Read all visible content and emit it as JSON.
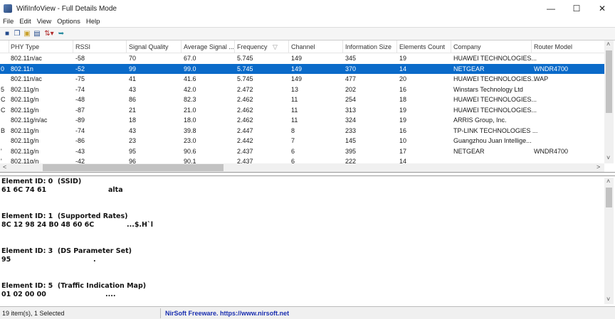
{
  "window": {
    "title": "WifiInfoView  -  Full Details Mode"
  },
  "menu": [
    "File",
    "Edit",
    "View",
    "Options",
    "Help"
  ],
  "toolbar": {
    "icons": [
      "save-icon",
      "copy-icon",
      "properties-icon",
      "html-report-icon",
      "sort-icon",
      "exit-icon"
    ]
  },
  "columns": [
    "PHY Type",
    "RSSI",
    "Signal Quality",
    "Average Signal ...",
    "Frequency",
    "Channel",
    "Information Size",
    "Elements Count",
    "Company",
    "Router Model"
  ],
  "rows": [
    {
      "c0": "",
      "phy": "802.11n/ac",
      "rssi": "-58",
      "sq": "70",
      "avg": "67.0",
      "freq": "5.745",
      "ch": "149",
      "info": "345",
      "elem": "19",
      "company": "HUAWEI TECHNOLOGIES...",
      "model": ""
    },
    {
      "c0": "0",
      "phy": "802.11n",
      "rssi": "-52",
      "sq": "99",
      "avg": "99.0",
      "freq": "5.745",
      "ch": "149",
      "info": "370",
      "elem": "14",
      "company": "NETGEAR",
      "model": "WNDR4700",
      "selected": true
    },
    {
      "c0": "",
      "phy": "802.11n/ac",
      "rssi": "-75",
      "sq": "41",
      "avg": "41.6",
      "freq": "5.745",
      "ch": "149",
      "info": "477",
      "elem": "20",
      "company": "HUAWEI TECHNOLOGIES...",
      "model": "WAP"
    },
    {
      "c0": "5",
      "phy": "802.11g/n",
      "rssi": "-74",
      "sq": "43",
      "avg": "42.0",
      "freq": "2.472",
      "ch": "13",
      "info": "202",
      "elem": "16",
      "company": "Winstars Technology Ltd",
      "model": ""
    },
    {
      "c0": "C",
      "phy": "802.11g/n",
      "rssi": "-48",
      "sq": "86",
      "avg": "82.3",
      "freq": "2.462",
      "ch": "11",
      "info": "254",
      "elem": "18",
      "company": "HUAWEI TECHNOLOGIES...",
      "model": ""
    },
    {
      "c0": "C",
      "phy": "802.11g/n",
      "rssi": "-87",
      "sq": "21",
      "avg": "21.0",
      "freq": "2.462",
      "ch": "11",
      "info": "313",
      "elem": "19",
      "company": "HUAWEI TECHNOLOGIES...",
      "model": ""
    },
    {
      "c0": "",
      "phy": "802.11g/n/ac",
      "rssi": "-89",
      "sq": "18",
      "avg": "18.0",
      "freq": "2.462",
      "ch": "11",
      "info": "324",
      "elem": "19",
      "company": "ARRIS Group, Inc.",
      "model": ""
    },
    {
      "c0": "B",
      "phy": "802.11g/n",
      "rssi": "-74",
      "sq": "43",
      "avg": "39.8",
      "freq": "2.447",
      "ch": "8",
      "info": "233",
      "elem": "16",
      "company": "TP-LINK TECHNOLOGIES ...",
      "model": ""
    },
    {
      "c0": "",
      "phy": "802.11g/n",
      "rssi": "-86",
      "sq": "23",
      "avg": "23.0",
      "freq": "2.442",
      "ch": "7",
      "info": "145",
      "elem": "10",
      "company": "Guangzhou Juan Intellige...",
      "model": ""
    },
    {
      "c0": "'",
      "phy": "802.11g/n",
      "rssi": "-43",
      "sq": "95",
      "avg": "90.6",
      "freq": "2.437",
      "ch": "6",
      "info": "395",
      "elem": "17",
      "company": "NETGEAR",
      "model": "WNDR4700"
    },
    {
      "c0": "'",
      "phy": "802.11g/n",
      "rssi": "-42",
      "sq": "96",
      "avg": "90.1",
      "freq": "2.437",
      "ch": "6",
      "info": "222",
      "elem": "14",
      "company": "",
      "model": ""
    }
  ],
  "details": [
    {
      "heading": "Element ID: 0  (SSID)",
      "hex": "61 6C 74 61",
      "ascii": "alta"
    },
    {
      "heading": "Element ID: 1  (Supported Rates)",
      "hex": "8C 12 98 24 B0 48 60 6C",
      "ascii": "...$.H`l"
    },
    {
      "heading": "Element ID: 3  (DS Parameter Set)",
      "hex": "95",
      "ascii": "."
    },
    {
      "heading": "Element ID: 5  (Traffic Indication Map)",
      "hex": "01 02 00 00",
      "ascii": "...."
    }
  ],
  "status": {
    "items": "19 item(s), 1 Selected",
    "credit": "NirSoft Freeware. https://www.nirsoft.net"
  },
  "colors": {
    "selection": "#0a6ac9",
    "credit": "#1a2fb0"
  }
}
